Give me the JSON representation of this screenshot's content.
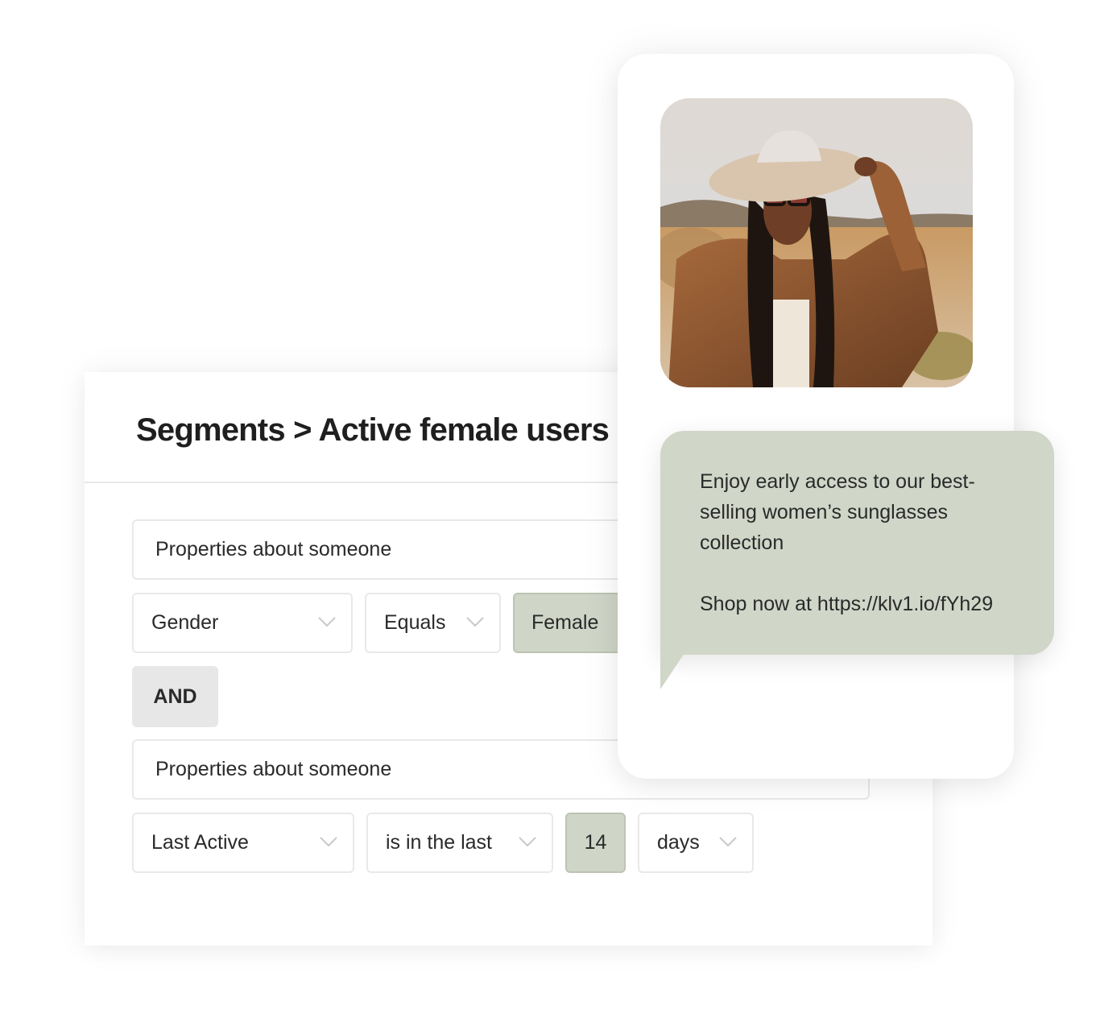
{
  "segment": {
    "breadcrumb": "Segments > Active female users",
    "conditions": [
      {
        "group_label": "Properties about someone",
        "property": "Gender",
        "operator": "Equals",
        "value": "Female"
      },
      {
        "group_label": "Properties about someone",
        "property": "Last Active",
        "operator": "is in the last",
        "value": "14",
        "unit": "days"
      }
    ],
    "joiner": "AND"
  },
  "message": {
    "body": "Enjoy early access to our best-selling women’s sunglasses collection",
    "cta": "Shop now at https://klv1.io/fYh29"
  },
  "preview": {
    "image_alt": "Woman in wide-brim hat, sunglasses and fringed leather jacket in the desert"
  },
  "colors": {
    "accent": "#cfd5c7",
    "bubble": "#d0d6c8",
    "chip": "#e7e7e7",
    "border": "#e9e9e9",
    "text": "#2a2a2a"
  }
}
